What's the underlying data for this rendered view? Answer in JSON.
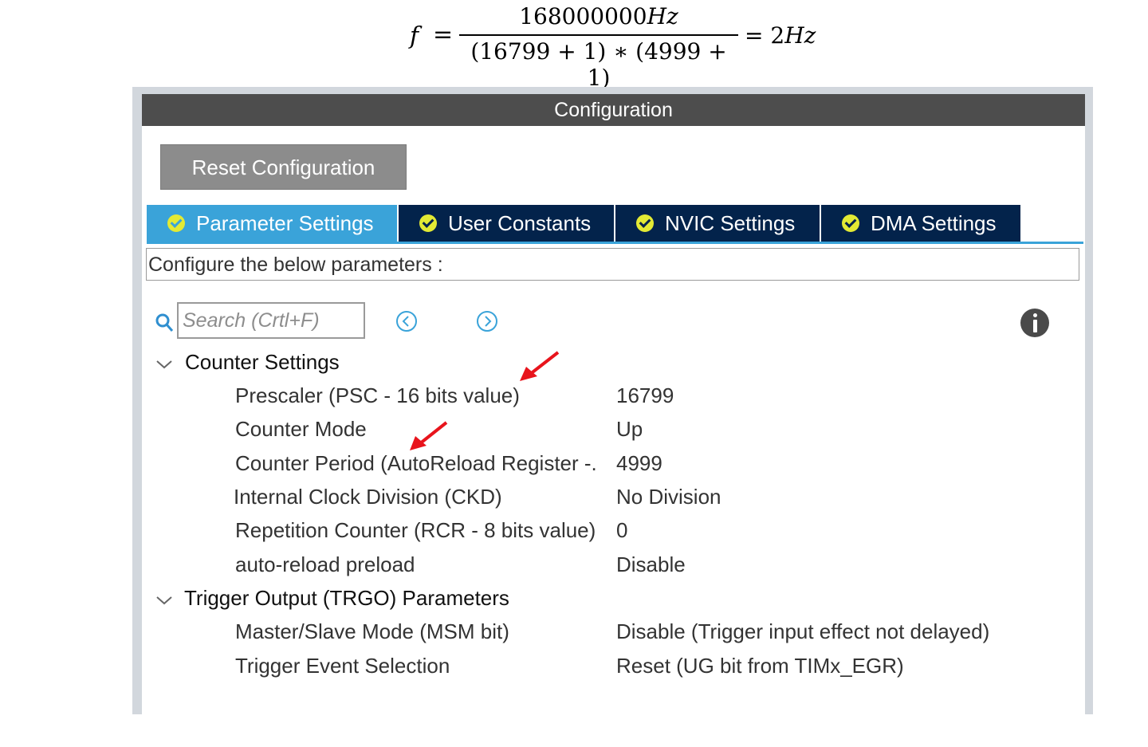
{
  "formula": {
    "lhs": "f",
    "eq": "=",
    "numerator": "168000000",
    "numerator_unit": "Hz",
    "denominator": "(16799 + 1) ∗ (4999 + 1)",
    "result": "= 2",
    "result_unit": "Hz"
  },
  "window": {
    "title": "Configuration"
  },
  "toolbar": {
    "reset_label": "Reset Configuration"
  },
  "tabs": [
    {
      "label": "Parameter Settings",
      "active": true
    },
    {
      "label": "User Constants",
      "active": false
    },
    {
      "label": "NVIC Settings",
      "active": false
    },
    {
      "label": "DMA Settings",
      "active": false
    }
  ],
  "hint": "Configure the below parameters :",
  "search": {
    "placeholder": "Search (Crtl+F)"
  },
  "groups": [
    {
      "title": "Counter Settings",
      "params": [
        {
          "name": "Prescaler (PSC - 16 bits value)",
          "value": "16799"
        },
        {
          "name": "Counter Mode",
          "value": "Up"
        },
        {
          "name": "Counter Period (AutoReload Register -.",
          "value": "4999"
        },
        {
          "name": "Internal Clock Division (CKD)",
          "value": "No Division"
        },
        {
          "name": "Repetition Counter (RCR - 8 bits value)",
          "value": "0"
        },
        {
          "name": "auto-reload preload",
          "value": "Disable"
        }
      ]
    },
    {
      "title": "Trigger Output (TRGO) Parameters",
      "params": [
        {
          "name": "Master/Slave Mode (MSM bit)",
          "value": "Disable (Trigger input effect not delayed)"
        },
        {
          "name": "Trigger Event Selection",
          "value": "Reset (UG bit from TIMx_EGR)"
        }
      ]
    }
  ],
  "colors": {
    "titlebar": "#4d4d4d",
    "tab_active": "#3aa3d9",
    "tab_inactive": "#03234b",
    "check": "#e3ea34",
    "annotation_arrow": "#e8141c"
  }
}
